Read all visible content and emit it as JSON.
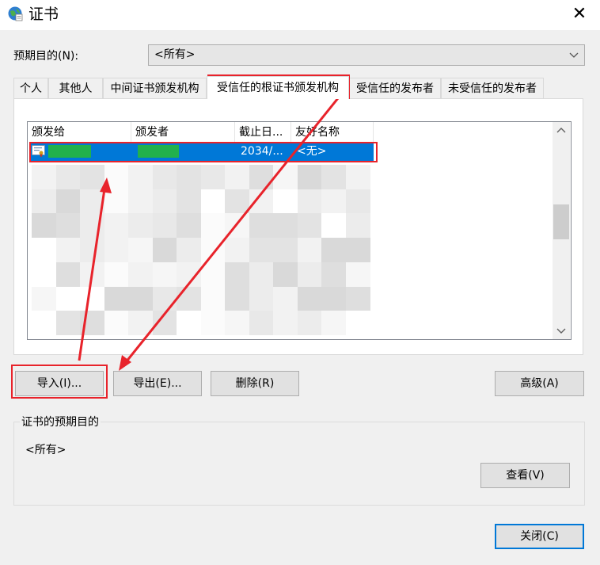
{
  "window": {
    "title": "证书",
    "icon": "certificate-globe-icon",
    "close_glyph": "✕"
  },
  "purpose": {
    "label": "预期目的(N):",
    "value": "<所有>"
  },
  "tabs": [
    {
      "label": "个人",
      "active": false
    },
    {
      "label": "其他人",
      "active": false
    },
    {
      "label": "中间证书颁发机构",
      "active": false
    },
    {
      "label": "受信任的根证书颁发机构",
      "active": true
    },
    {
      "label": "受信任的发布者",
      "active": false
    },
    {
      "label": "未受信任的发布者",
      "active": false
    }
  ],
  "list": {
    "columns": [
      "颁发给",
      "颁发者",
      "截止日...",
      "友好名称"
    ],
    "selected_row": {
      "issued_to": "",
      "issued_by": "",
      "expiry": "2034/...",
      "friendly_name": "<无>"
    }
  },
  "buttons": {
    "import": "导入(I)...",
    "export": "导出(E)...",
    "remove": "删除(R)",
    "advanced": "高级(A)",
    "view": "查看(V)",
    "close": "关闭(C)"
  },
  "purpose_group": {
    "title": "证书的预期目的",
    "value": "<所有>"
  },
  "colors": {
    "selection": "#0078d7",
    "redacted_green": "#22b14c",
    "annotation_red": "#e8232b"
  }
}
